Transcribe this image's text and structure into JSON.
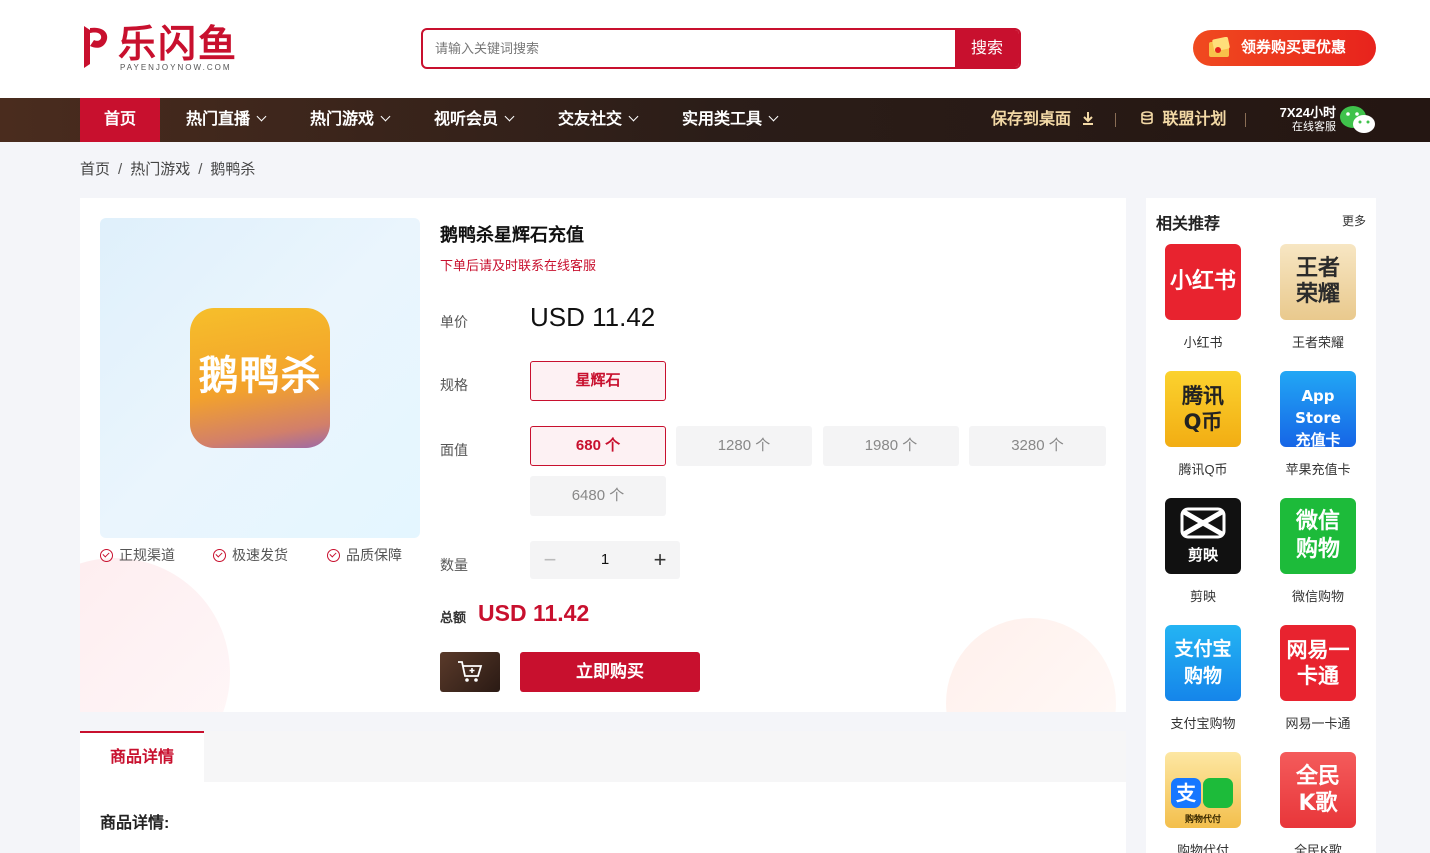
{
  "header": {
    "logo_text": "乐闪鱼",
    "logo_sub": "PAYENJOYNOW.COM",
    "search_placeholder": "请输入关键词搜索",
    "search_button": "搜索",
    "coupon_label": "领券购买更优惠"
  },
  "nav": {
    "items": [
      {
        "label": "首页"
      },
      {
        "label": "热门直播"
      },
      {
        "label": "热门游戏"
      },
      {
        "label": "视听会员"
      },
      {
        "label": "交友社交"
      },
      {
        "label": "实用类工具"
      }
    ],
    "save_desktop": "保存到桌面",
    "alliance": "联盟计划",
    "service_line1": "7X24小时",
    "service_line2": "在线客服"
  },
  "breadcrumb": [
    "首页",
    "热门游戏",
    "鹅鸭杀"
  ],
  "product": {
    "icon_text": "鹅鸭杀",
    "guarantees": [
      "正规渠道",
      "极速发货",
      "品质保障"
    ],
    "title": "鹅鸭杀星辉石充值",
    "note": "下单后请及时联系在线客服",
    "price_label": "单价",
    "price": "USD 11.42",
    "spec_label": "规格",
    "spec_option": "星辉石",
    "denom_label": "面值",
    "denominations": [
      "680 个",
      "1280 个",
      "1980 个",
      "3280 个",
      "6480 个"
    ],
    "selected_denomination": "680 个",
    "qty_label": "数量",
    "qty_minus": "−",
    "qty_value": "1",
    "qty_plus": "+",
    "total_label": "总额",
    "total": "USD 11.42",
    "buy_label": "立即购买"
  },
  "detail": {
    "tab_label": "商品详情",
    "section_title": "商品详情:"
  },
  "sidebar": {
    "title": "相关推荐",
    "more": "更多",
    "items": [
      {
        "name": "小红书",
        "icon_text": "小红书",
        "color": "#e8232f"
      },
      {
        "name": "王者荣耀",
        "icon_text": "王者荣耀",
        "color": "#f2d7a6"
      },
      {
        "name": "腾讯Q币",
        "icon_text": "腾讯Q币",
        "color": "#f7c31c"
      },
      {
        "name": "苹果充值卡",
        "icon_text": "App Store 充值卡",
        "color": "#1b7ff0"
      },
      {
        "name": "剪映",
        "icon_text": "剪映",
        "color": "#111111"
      },
      {
        "name": "微信购物",
        "icon_text": "微信购物",
        "color": "#1dbb3a"
      },
      {
        "name": "支付宝购物",
        "icon_text": "支付宝购物",
        "color": "#1aa6f0"
      },
      {
        "name": "网易一卡通",
        "icon_text": "网易一卡通",
        "color": "#e8232f"
      },
      {
        "name": "购物代付",
        "icon_text": "购物代付",
        "color": "#f8d36b"
      },
      {
        "name": "全民K歌",
        "icon_text": "全民K歌",
        "color": "#f0494a"
      }
    ]
  },
  "colors": {
    "brand": "#c8102e",
    "nav_bg": "#2b1d18",
    "accent_gold": "#f3d9a6"
  }
}
